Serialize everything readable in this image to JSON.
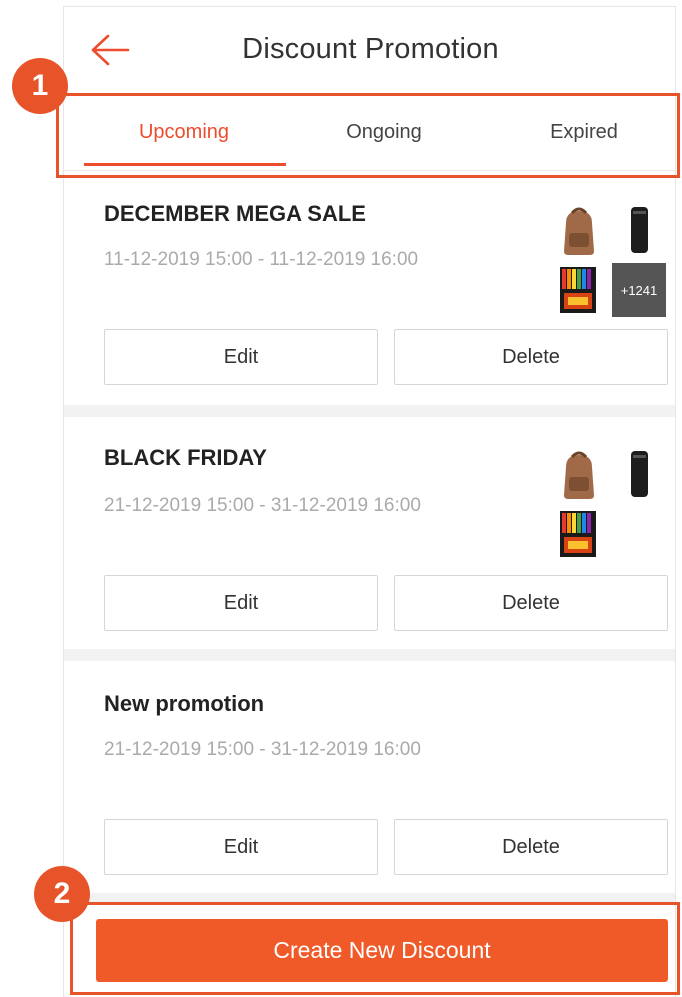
{
  "header": {
    "title": "Discount Promotion",
    "back_icon": "arrow-left-icon"
  },
  "tabs": [
    {
      "label": "Upcoming",
      "active": true
    },
    {
      "label": "Ongoing",
      "active": false
    },
    {
      "label": "Expired",
      "active": false
    }
  ],
  "promotions": [
    {
      "title": "DECEMBER MEGA SALE",
      "date_range": "11-12-2019 15:00 - 11-12-2019 16:00",
      "thumbnails": [
        "backpack-image",
        "speaker-image",
        "colored-pencils-image"
      ],
      "more_count": "+1241",
      "edit_label": "Edit",
      "delete_label": "Delete"
    },
    {
      "title": "BLACK FRIDAY",
      "date_range": "21-12-2019 15:00 - 31-12-2019 16:00",
      "thumbnails": [
        "backpack-image",
        "speaker-image",
        "colored-pencils-image"
      ],
      "edit_label": "Edit",
      "delete_label": "Delete"
    },
    {
      "title": "New promotion",
      "date_range": "21-12-2019 15:00 - 31-12-2019 16:00",
      "edit_label": "Edit",
      "delete_label": "Delete"
    }
  ],
  "cta": {
    "label": "Create New Discount"
  },
  "annotations": {
    "badge_1": "1",
    "badge_2": "2"
  },
  "colors": {
    "accent": "#ee4d2d",
    "cta": "#f05a28",
    "annotation": "#e8542a"
  }
}
